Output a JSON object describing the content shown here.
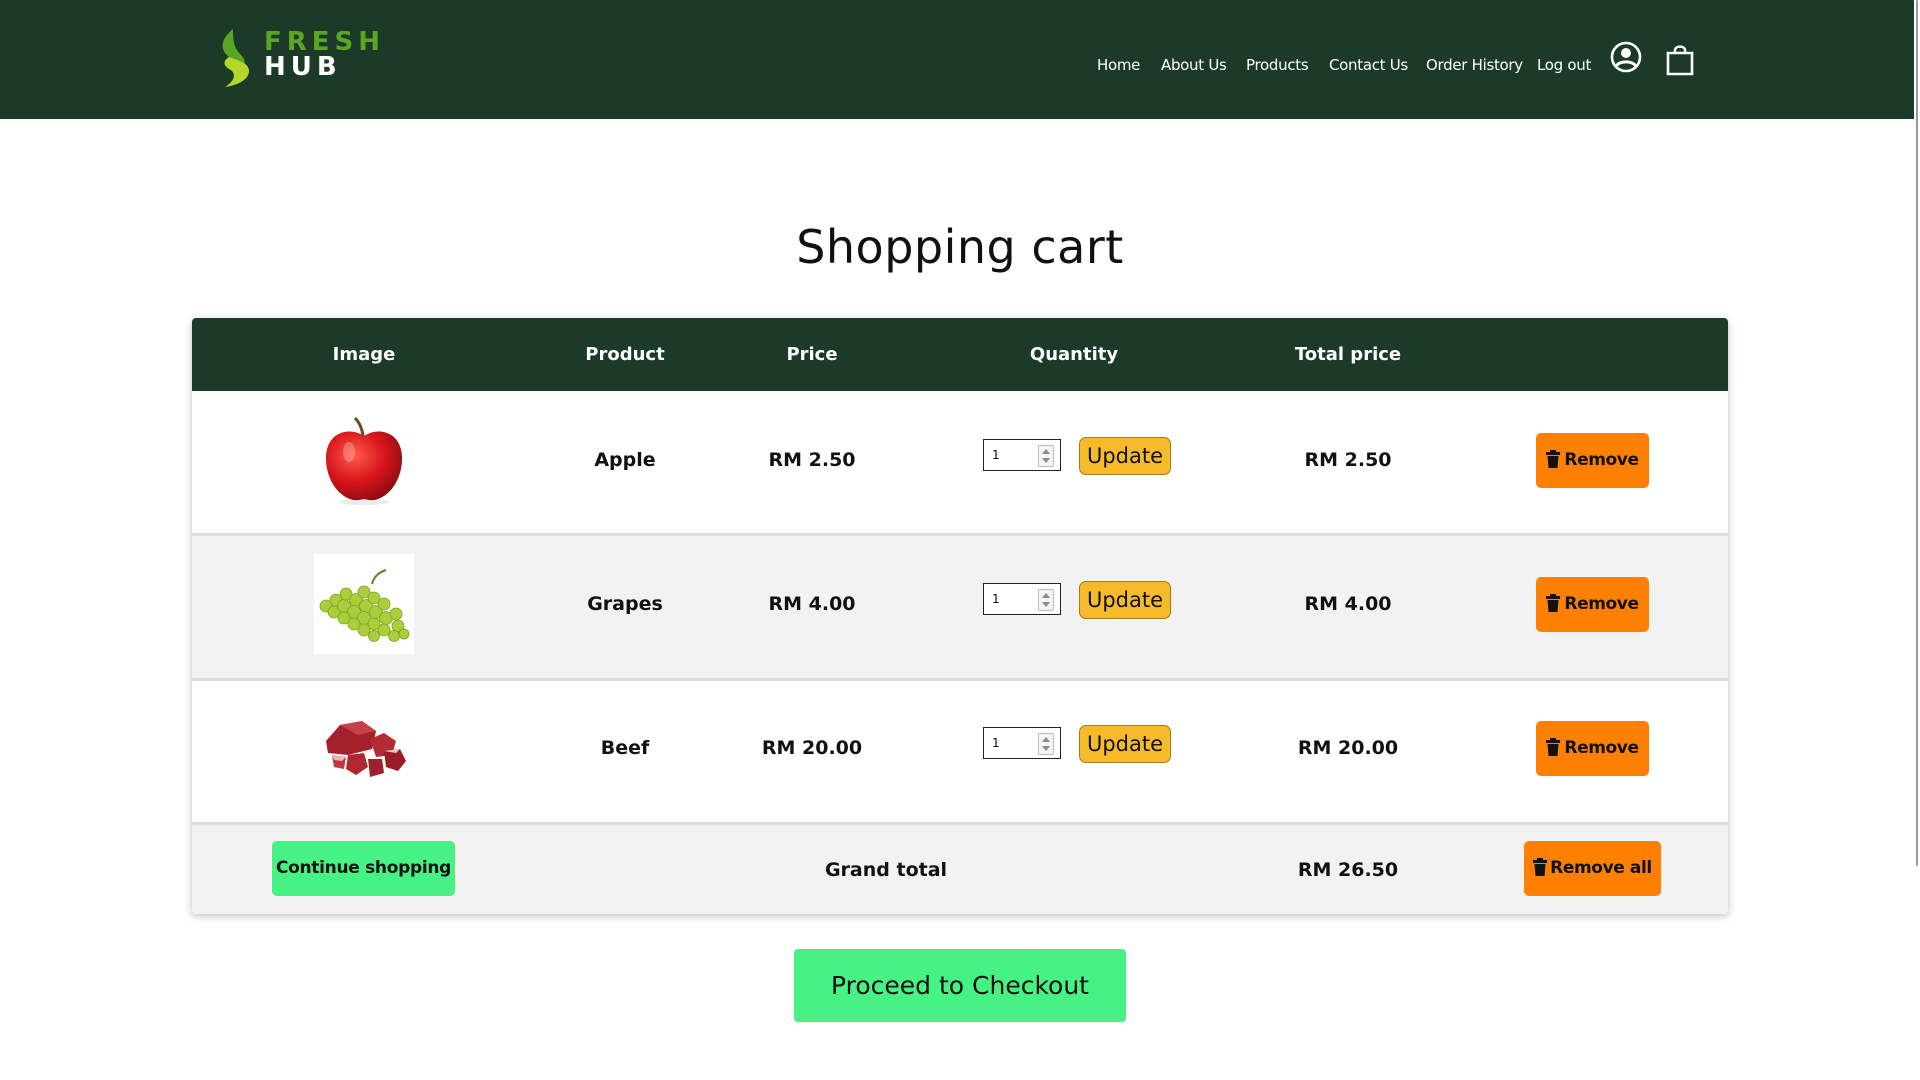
{
  "brand": {
    "line1": "FRESH",
    "line2": "HUB",
    "logo_icon": "leaf-s-icon",
    "colors": {
      "green": "#5aa623",
      "lime": "#b4d82a"
    }
  },
  "nav": {
    "items": [
      {
        "label": "Home"
      },
      {
        "label": "About Us"
      },
      {
        "label": "Products"
      },
      {
        "label": "Contact Us"
      },
      {
        "label": "Order History"
      },
      {
        "label": "Log out"
      }
    ],
    "icons": [
      "user-account-icon",
      "shopping-bag-icon"
    ]
  },
  "title": "Shopping cart",
  "table": {
    "headers": [
      "Image",
      "Product",
      "Price",
      "Quantity",
      "Total price",
      ""
    ],
    "rows": [
      {
        "image": "apple",
        "product": "Apple",
        "price": "RM 2.50",
        "quantity": "1",
        "update_label": "Update",
        "total": "RM 2.50",
        "remove_label": "Remove"
      },
      {
        "image": "grapes",
        "product": "Grapes",
        "price": "RM 4.00",
        "quantity": "1",
        "update_label": "Update",
        "total": "RM 4.00",
        "remove_label": "Remove"
      },
      {
        "image": "beef",
        "product": "Beef",
        "price": "RM 20.00",
        "quantity": "1",
        "update_label": "Update",
        "total": "RM 20.00",
        "remove_label": "Remove"
      }
    ],
    "footer": {
      "continue_label": "Continue shopping",
      "grand_total_label": "Grand total",
      "grand_total_value": "RM 26.50",
      "remove_all_label": "Remove all"
    }
  },
  "checkout_label": "Proceed to Checkout",
  "theme": {
    "header_bg": "#1b3a27",
    "update_button": "#f6bb2a",
    "remove_button": "#ff8000",
    "primary_button": "#45f283",
    "row_alt": "#f2f2f2"
  }
}
